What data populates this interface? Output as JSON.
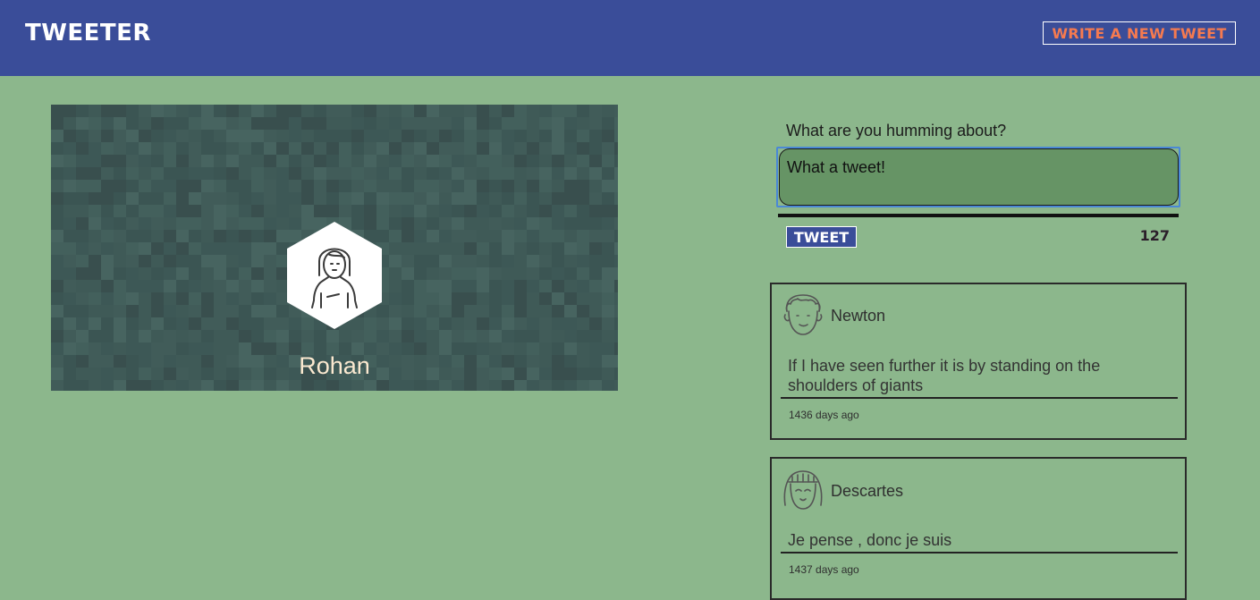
{
  "header": {
    "brand": "TWEETER",
    "compose_link": "WRITE A NEW TWEET"
  },
  "profile": {
    "name": "Rohan"
  },
  "composer": {
    "label": "What are you humming about?",
    "value": "What a tweet!",
    "button_label": "TWEET",
    "counter": "127"
  },
  "tweets": [
    {
      "author": "Newton",
      "text": "If I have seen further it is by standing on the shoulders of giants",
      "time": "1436 days ago"
    },
    {
      "author": "Descartes",
      "text": "Je pense , donc je suis",
      "time": "1437 days ago"
    }
  ],
  "colors": {
    "page_bg": "#8cb78c",
    "header_bg": "#3a4d99",
    "accent": "#f57a50",
    "composer_bg": "#669465"
  }
}
